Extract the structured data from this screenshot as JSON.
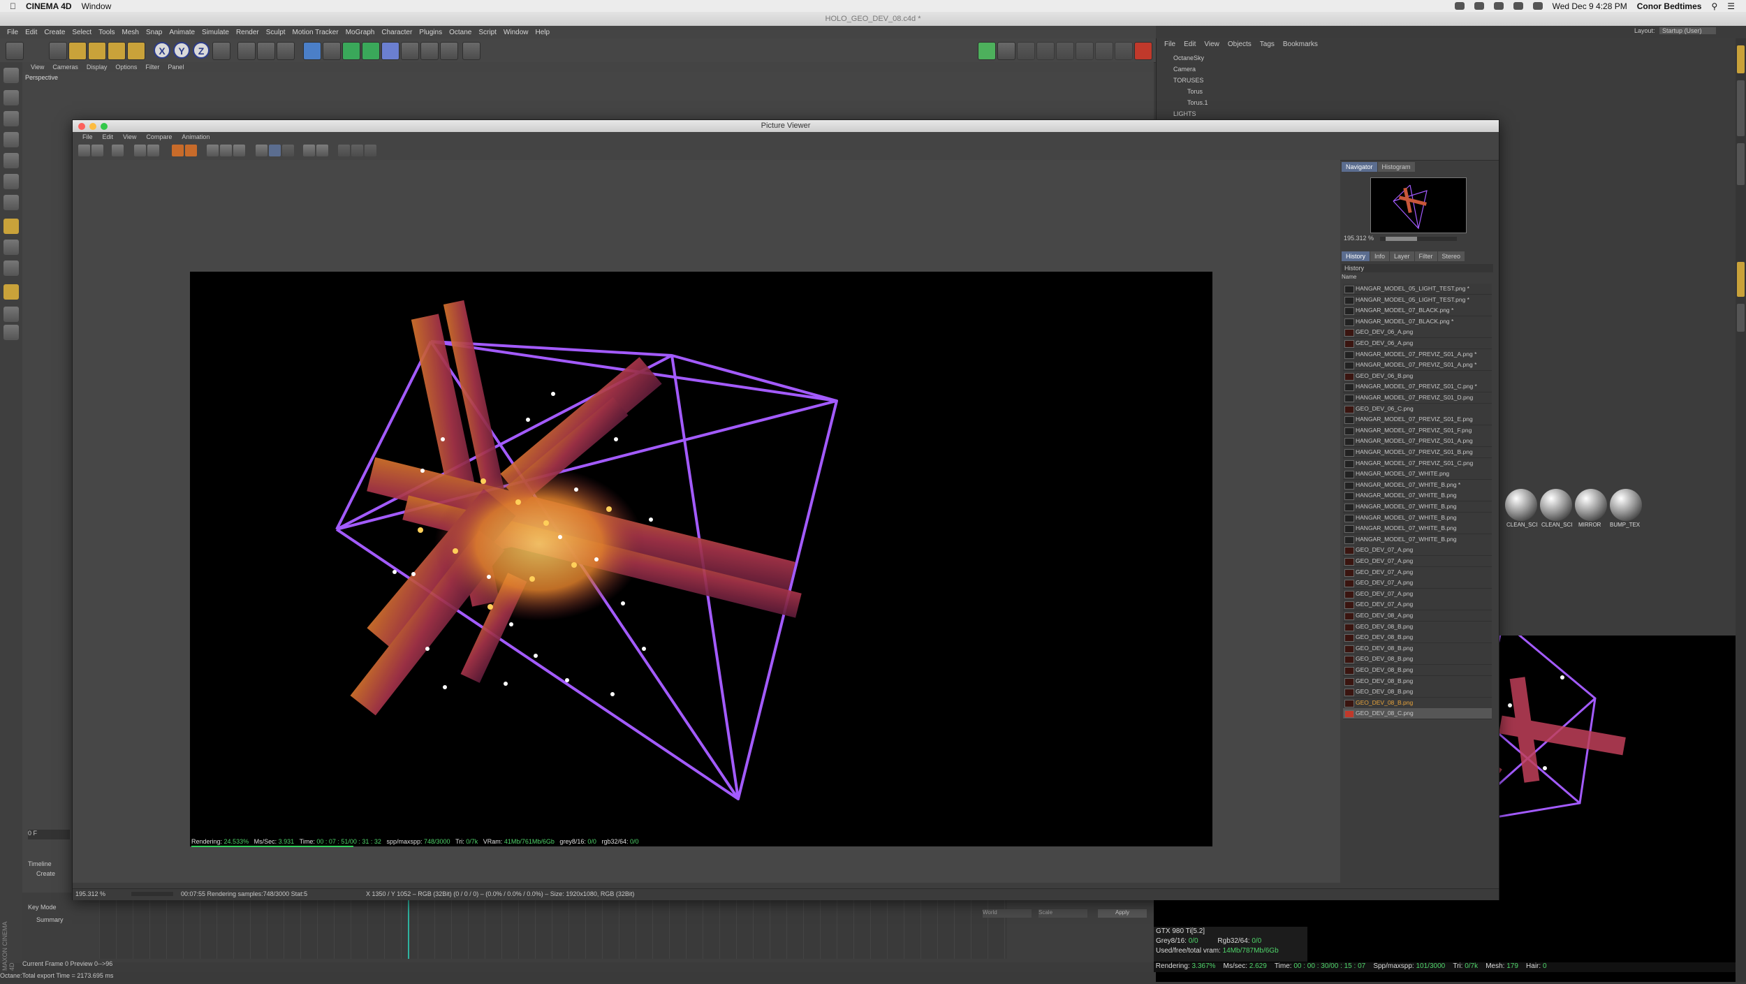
{
  "mac_menu": {
    "app": "CINEMA 4D",
    "window": "Window",
    "datetime": "Wed Dec 9  4:28 PM",
    "user": "Conor Bedtimes"
  },
  "c4d": {
    "title": "HOLO_GEO_DEV_08.c4d *",
    "menu": [
      "File",
      "Edit",
      "Create",
      "Select",
      "Tools",
      "Mesh",
      "Snap",
      "Animate",
      "Simulate",
      "Render",
      "Sculpt",
      "Motion Tracker",
      "MoGraph",
      "Character",
      "Plugins",
      "Octane",
      "Script",
      "Window",
      "Help"
    ],
    "layout_label": "Layout:",
    "layout_value": "Startup (User)",
    "viewport_menu": [
      "View",
      "Cameras",
      "Display",
      "Options",
      "Filter",
      "Panel"
    ],
    "viewport_label": "Perspective"
  },
  "object_manager": {
    "menu": [
      "File",
      "Edit",
      "View",
      "Objects",
      "Tags",
      "Bookmarks"
    ],
    "rows": [
      "OctaneSky",
      "Camera",
      "TORUSES",
      "Torus",
      "Torus.1",
      "LIGHTS"
    ]
  },
  "picture_viewer": {
    "title": "Picture Viewer",
    "menu": [
      "File",
      "Edit",
      "View",
      "Compare",
      "Animation"
    ],
    "stats": {
      "rendering_label": "Rendering:",
      "rendering": "24.533%",
      "ms_label": "Ms/Sec:",
      "ms": "3.931",
      "time_label": "Time:",
      "time": "00 : 07 : 51/00 : 31 : 32",
      "spp_label": "spp/maxspp:",
      "spp": "748/3000",
      "tri_label": "Tri:",
      "tri": "0/7k",
      "vram_label": "VRam:",
      "vram": "41Mb/761Mb/6Gb",
      "grey_label": "grey8/16:",
      "grey": "0/0",
      "rgb_label": "rgb32/64:",
      "rgb": "0/0",
      "progress": 0.245
    },
    "nav_tabs": [
      "Navigator",
      "Histogram"
    ],
    "zoom": "195.312 %",
    "hist_tabs": [
      "History",
      "Info",
      "Layer",
      "Filter",
      "Stereo"
    ],
    "history_title": "History",
    "name_header": "Name",
    "history": [
      "HANGAR_MODEL_05_LIGHT_TEST.png *",
      "HANGAR_MODEL_05_LIGHT_TEST.png *",
      "HANGAR_MODEL_07_BLACK.png *",
      "HANGAR_MODEL_07_BLACK.png *",
      "GEO_DEV_06_A.png",
      "GEO_DEV_06_A.png",
      "HANGAR_MODEL_07_PREVIZ_S01_A.png *",
      "HANGAR_MODEL_07_PREVIZ_S01_A.png *",
      "GEO_DEV_06_B.png",
      "HANGAR_MODEL_07_PREVIZ_S01_C.png *",
      "HANGAR_MODEL_07_PREVIZ_S01_D.png",
      "GEO_DEV_06_C.png",
      "HANGAR_MODEL_07_PREVIZ_S01_E.png",
      "HANGAR_MODEL_07_PREVIZ_S01_F.png",
      "HANGAR_MODEL_07_PREVIZ_S01_A.png",
      "HANGAR_MODEL_07_PREVIZ_S01_B.png",
      "HANGAR_MODEL_07_PREVIZ_S01_C.png",
      "HANGAR_MODEL_07_WHITE.png",
      "HANGAR_MODEL_07_WHITE_B.png *",
      "HANGAR_MODEL_07_WHITE_B.png",
      "HANGAR_MODEL_07_WHITE_B.png",
      "HANGAR_MODEL_07_WHITE_B.png",
      "HANGAR_MODEL_07_WHITE_B.png",
      "HANGAR_MODEL_07_WHITE_B.png",
      "GEO_DEV_07_A.png",
      "GEO_DEV_07_A.png",
      "GEO_DEV_07_A.png",
      "GEO_DEV_07_A.png",
      "GEO_DEV_07_A.png",
      "GEO_DEV_07_A.png",
      "GEO_DEV_08_A.png",
      "GEO_DEV_08_B.png",
      "GEO_DEV_08_B.png",
      "GEO_DEV_08_B.png",
      "GEO_DEV_08_B.png",
      "GEO_DEV_08_B.png",
      "GEO_DEV_08_B.png",
      "GEO_DEV_08_B.png",
      "GEO_DEV_08_B.png",
      "GEO_DEV_08_C.png"
    ],
    "status_zoom": "195.312 %",
    "status_render": "00:07:55 Rendering samples:748/3000 Stat:5",
    "status_info": "X 1350 / Y 1052 – RGB (32Bit) (0 / 0 / 0) – (0.0% / 0.0% / 0.0%) – Size: 1920x1080, RGB (32Bit)"
  },
  "materials": [
    "CLEAN_SCI",
    "CLEAN_SCI",
    "MIRROR",
    "BUMP_TEX"
  ],
  "octane": {
    "gpu": "GTX 980 Ti[5.2]",
    "grey_label": "Grey8/16:",
    "grey": "0/0",
    "rgb_label": "Rgb32/64:",
    "rgb": "0/0",
    "vram_label": "Used/free/total vram:",
    "vram": "14Mb/787Mb/6Gb",
    "rendering_label": "Rendering:",
    "rendering": "3.367%",
    "ms_label": "Ms/sec:",
    "ms": "2.629",
    "time_label": "Time:",
    "time": "00 : 00 : 30/00 : 15 : 07",
    "spp_label": "Spp/maxspp:",
    "spp": "101/3000",
    "tri_label": "Tri:",
    "tri": "0/7k",
    "mesh_label": "Mesh:",
    "mesh": "179",
    "hair_label": "Hair:",
    "hair": "0"
  },
  "timeline": {
    "title": "Timeline",
    "create": "Create",
    "key_mode": "Key Mode",
    "summary": "Summary",
    "frame_field": "0 F",
    "current_frame": "Current Frame  0  Preview  0-->96",
    "apply": "Apply",
    "world": "World",
    "scale": "Scale"
  },
  "status_bar": "Octane:Total export Time = 2173.695 ms",
  "maxon": "MAXON CINEMA 4D"
}
